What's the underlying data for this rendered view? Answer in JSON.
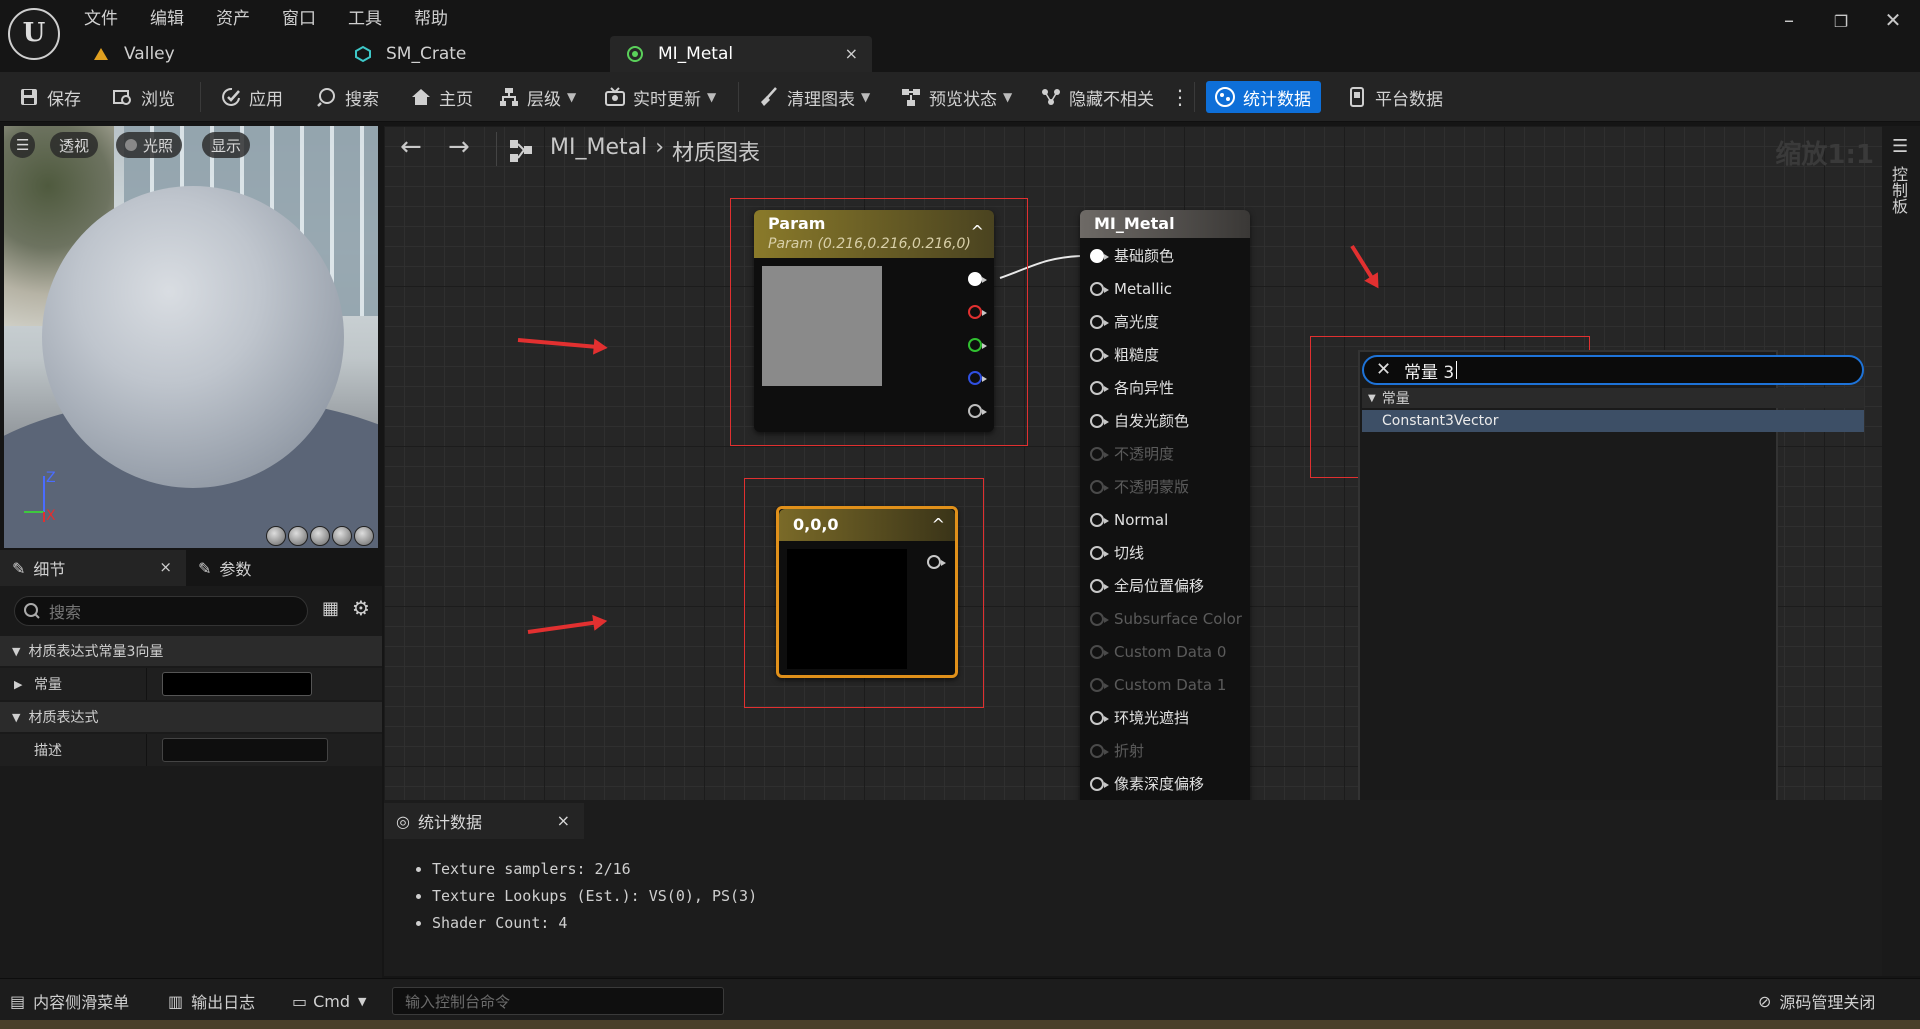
{
  "menu": [
    "文件",
    "编辑",
    "资产",
    "窗口",
    "工具",
    "帮助"
  ],
  "tabs": [
    {
      "label": "Valley"
    },
    {
      "label": "SM_Crate"
    },
    {
      "label": "MI_Metal",
      "close": "×"
    }
  ],
  "window_controls": {
    "minimize": "–",
    "restore": "❐",
    "close": "✕"
  },
  "toolbar": {
    "save": "保存",
    "browse": "浏览",
    "apply": "应用",
    "search": "搜索",
    "home": "主页",
    "hierarchy": "层级",
    "live_update": "实时更新",
    "clean_graph": "清理图表",
    "preview_state": "预览状态",
    "hide_unrelated": "隐藏不相关",
    "stats": "统计数据",
    "platform_stats": "平台数据"
  },
  "viewport": {
    "perspective": "透视",
    "lighting": "光照",
    "show": "显示",
    "axis_z": "Z",
    "axis_x": "X"
  },
  "details": {
    "tab_details": "细节",
    "tab_params": "参数",
    "close": "×",
    "search_placeholder": "搜索",
    "category1": "材质表达式常量3向量",
    "prop_constant": "常量",
    "category2": "材质表达式",
    "prop_desc": "描述"
  },
  "graph": {
    "breadcrumb_root": "MI_Metal",
    "breadcrumb_sep": "›",
    "breadcrumb_leaf": "材质图表",
    "zoom": "缩放1:1"
  },
  "param_node": {
    "title": "Param",
    "subtitle": "Param (0.216,0.216,0.216,0)",
    "preview_color": "#8a8a8a",
    "collapse": "^"
  },
  "const_node": {
    "title": "0,0,0",
    "collapse": "^"
  },
  "material_node": {
    "title": "MI_Metal",
    "inputs": [
      {
        "label": "基础颜色",
        "enabled": true
      },
      {
        "label": "Metallic",
        "enabled": true
      },
      {
        "label": "高光度",
        "enabled": true
      },
      {
        "label": "粗糙度",
        "enabled": true
      },
      {
        "label": "各向异性",
        "enabled": true
      },
      {
        "label": "自发光颜色",
        "enabled": true
      },
      {
        "label": "不透明度",
        "enabled": false
      },
      {
        "label": "不透明蒙版",
        "enabled": false
      },
      {
        "label": "Normal",
        "enabled": true
      },
      {
        "label": "切线",
        "enabled": true
      },
      {
        "label": "全局位置偏移",
        "enabled": true
      },
      {
        "label": "Subsurface Color",
        "enabled": false
      },
      {
        "label": "Custom Data 0",
        "enabled": false
      },
      {
        "label": "Custom Data 1",
        "enabled": false
      },
      {
        "label": "环境光遮挡",
        "enabled": true
      },
      {
        "label": "折射",
        "enabled": false
      },
      {
        "label": "像素深度偏移",
        "enabled": true
      }
    ]
  },
  "palette": {
    "query": "常量 3",
    "category": "常量",
    "result": "Constant3Vector"
  },
  "stats_panel": {
    "tab": "统计数据",
    "close": "×",
    "lines": [
      "Texture samplers: 2/16",
      "Texture Lookups (Est.): VS(0), PS(3)",
      "Shader Count: 4"
    ]
  },
  "right_panel": {
    "label": "控制板"
  },
  "statusbar": {
    "content_drawer": "内容侧滑菜单",
    "output_log": "输出日志",
    "cmd": "Cmd",
    "console_placeholder": "输入控制台命令",
    "source_control": "源码管理关闭"
  },
  "colors": {
    "accent": "#0e6fd8",
    "param_header": "#8a7a2a",
    "const_border": "#e0901a",
    "annotation": "#e03030"
  }
}
